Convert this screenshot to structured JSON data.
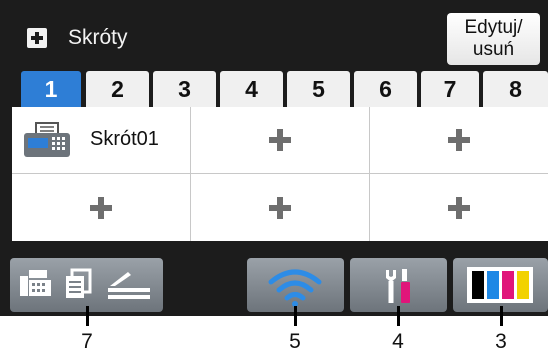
{
  "header": {
    "title": "Skróty",
    "edit_button_line1": "Edytuj/",
    "edit_button_line2": "usuń",
    "add_icon": "plus-icon"
  },
  "tabs": [
    {
      "label": "1",
      "active": true
    },
    {
      "label": "2",
      "active": false
    },
    {
      "label": "3",
      "active": false
    },
    {
      "label": "4",
      "active": false
    },
    {
      "label": "5",
      "active": false
    },
    {
      "label": "6",
      "active": false
    },
    {
      "label": "7",
      "active": false
    },
    {
      "label": "8",
      "active": false
    }
  ],
  "shortcuts": [
    {
      "label": "Skrót01",
      "icon": "fax-icon"
    },
    {
      "label": "",
      "icon": "plus-icon"
    },
    {
      "label": "",
      "icon": "plus-icon"
    },
    {
      "label": "",
      "icon": "plus-icon"
    },
    {
      "label": "",
      "icon": "plus-icon"
    },
    {
      "label": "",
      "icon": "plus-icon"
    }
  ],
  "bottom_bar": {
    "buttons": [
      {
        "name": "fax-copy-scan",
        "icons": [
          "fax-icon",
          "copy-icon",
          "scan-icon"
        ]
      },
      {
        "name": "wifi",
        "icons": [
          "wifi-icon"
        ]
      },
      {
        "name": "settings",
        "icons": [
          "tools-icon"
        ]
      },
      {
        "name": "ink",
        "icons": [
          "ink-cartridges-icon"
        ]
      }
    ]
  },
  "callouts": [
    "7",
    "5",
    "4",
    "3"
  ],
  "colors": {
    "active_tab": "#2e7ed6",
    "wifi": "#2d8ce6",
    "ink_black": "#000000",
    "ink_cyan": "#1e88e5",
    "ink_magenta": "#e0157a",
    "ink_yellow": "#f2d200"
  }
}
